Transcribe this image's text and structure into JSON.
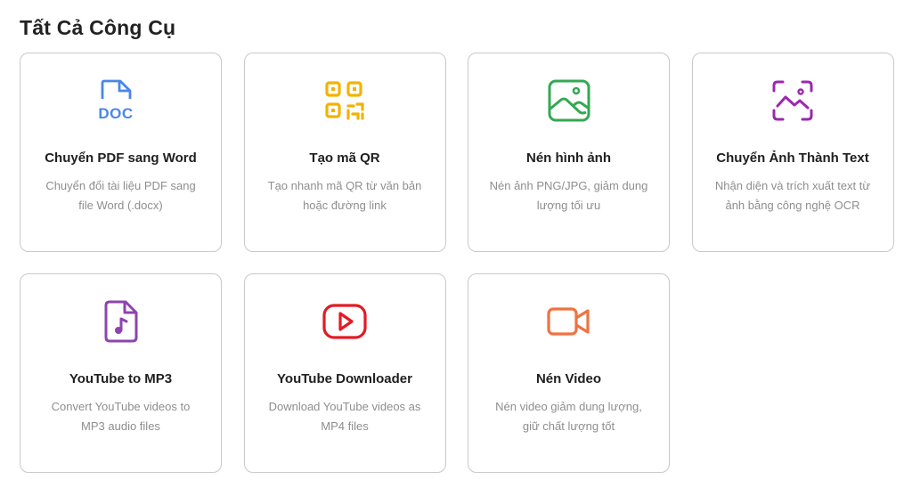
{
  "section": {
    "title": "Tất Cả Công Cụ"
  },
  "tools": [
    {
      "icon": "doc-file-icon",
      "color": "#4a86e8",
      "title": "Chuyển PDF sang Word",
      "description": "Chuyển đổi tài liệu PDF sang file Word (.docx)"
    },
    {
      "icon": "qr-code-icon",
      "color": "#f2b300",
      "title": "Tạo mã QR",
      "description": "Tạo nhanh mã QR từ văn bản hoặc đường link"
    },
    {
      "icon": "image-icon",
      "color": "#34a853",
      "title": "Nén hình ảnh",
      "description": "Nén ảnh PNG/JPG, giảm dung lượng tối ưu"
    },
    {
      "icon": "image-scan-icon",
      "color": "#9c27b0",
      "title": "Chuyển Ảnh Thành Text",
      "description": "Nhận diện và trích xuất text từ ảnh bằng công nghệ OCR"
    },
    {
      "icon": "music-file-icon",
      "color": "#8e44ad",
      "title": "YouTube to MP3",
      "description": "Convert YouTube videos to MP3 audio files"
    },
    {
      "icon": "youtube-play-icon",
      "color": "#e31b23",
      "title": "YouTube Downloader",
      "description": "Download YouTube videos as MP4 files"
    },
    {
      "icon": "video-camera-icon",
      "color": "#f07241",
      "title": "Nén Video",
      "description": "Nén video giảm dung lượng, giữ chất lượng tốt"
    }
  ]
}
